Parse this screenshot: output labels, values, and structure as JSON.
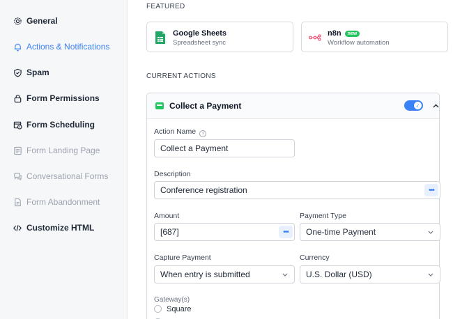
{
  "sidebar": {
    "items": [
      {
        "label": "General",
        "icon": "gear-icon",
        "state": "normal"
      },
      {
        "label": "Actions & Notifications",
        "icon": "bell-icon",
        "state": "active"
      },
      {
        "label": "Spam",
        "icon": "shield-icon",
        "state": "normal"
      },
      {
        "label": "Form Permissions",
        "icon": "lock-icon",
        "state": "normal"
      },
      {
        "label": "Form Scheduling",
        "icon": "calendar-clock-icon",
        "state": "normal"
      },
      {
        "label": "Form Landing Page",
        "icon": "page-icon",
        "state": "muted"
      },
      {
        "label": "Conversational Forms",
        "icon": "chat-icon",
        "state": "muted"
      },
      {
        "label": "Form Abandonment",
        "icon": "doc-icon",
        "state": "muted"
      },
      {
        "label": "Customize HTML",
        "icon": "code-icon",
        "state": "normal"
      }
    ]
  },
  "featured": {
    "label": "FEATURED",
    "cards": [
      {
        "title": "Google Sheets",
        "subtitle": "Spreadsheet sync",
        "icon": "google-sheets-icon"
      },
      {
        "title": "n8n",
        "badge": "new",
        "subtitle": "Workflow automation",
        "icon": "n8n-icon"
      }
    ]
  },
  "current_actions": {
    "label": "CURRENT ACTIONS",
    "action": {
      "title": "Collect a Payment",
      "enabled": true,
      "action_name_label": "Action Name",
      "action_name_value": "Collect a Payment",
      "description_label": "Description",
      "description_value": "Conference registration",
      "amount_label": "Amount",
      "amount_value": "[687]",
      "payment_type_label": "Payment Type",
      "payment_type_value": "One-time Payment",
      "capture_label": "Capture Payment",
      "capture_value": "When entry is submitted",
      "currency_label": "Currency",
      "currency_value": "U.S. Dollar (USD)",
      "gateways_label": "Gateway(s)",
      "gateways": [
        "Square"
      ]
    }
  },
  "colors": {
    "accent": "#3b82f6",
    "sidebar_bg": "#f6f7f9",
    "success": "#22c55e"
  }
}
